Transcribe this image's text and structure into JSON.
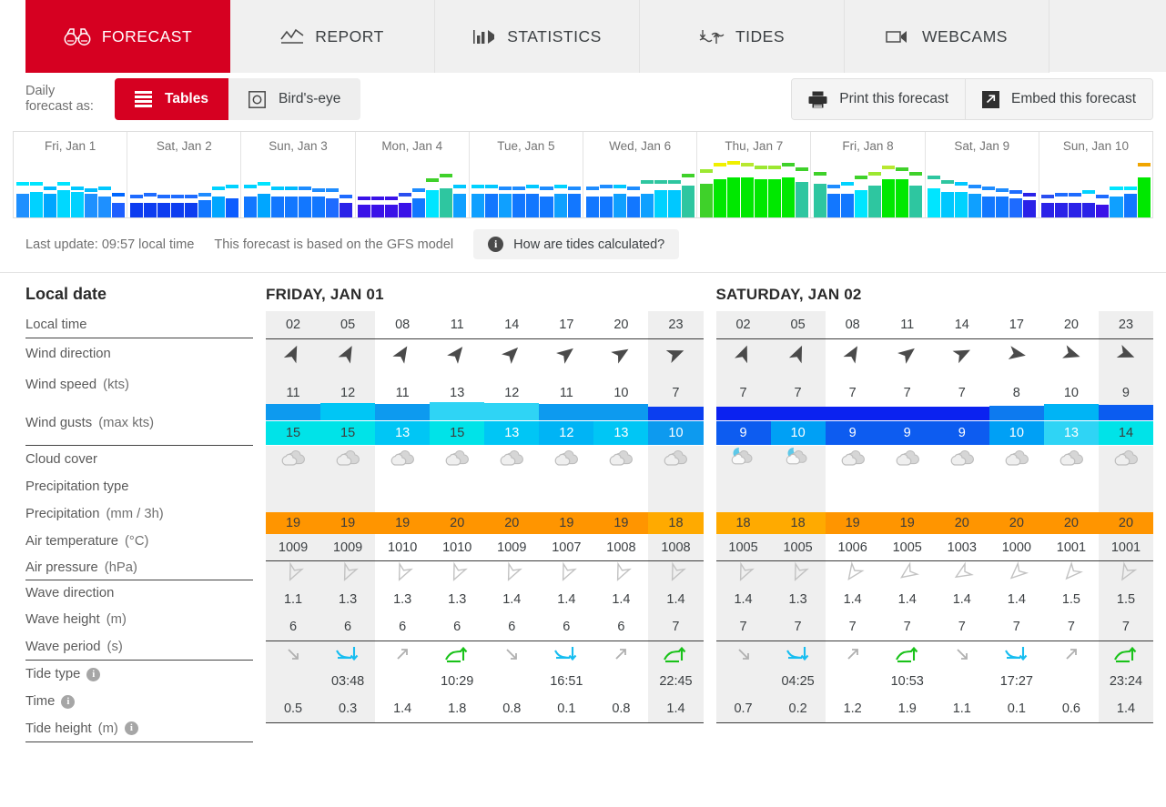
{
  "nav": {
    "tabs": [
      {
        "label": "FORECAST",
        "icon": "binoculars-icon",
        "active": true
      },
      {
        "label": "REPORT",
        "icon": "chart-line-icon",
        "active": false
      },
      {
        "label": "STATISTICS",
        "icon": "bar-chart-icon",
        "active": false
      },
      {
        "label": "TIDES",
        "icon": "tides-icon",
        "active": false
      },
      {
        "label": "WEBCAMS",
        "icon": "video-camera-icon",
        "active": false
      }
    ],
    "active_color": "#d60021"
  },
  "toolbar": {
    "label_line1": "Daily",
    "label_line2": "forecast as:",
    "view_tables": "Tables",
    "view_birdseye": "Bird's-eye",
    "print_label": "Print this forecast",
    "embed_label": "Embed this forecast"
  },
  "status": {
    "last_update": "Last update: 09:57 local time",
    "model": "This forecast is based on the GFS model",
    "tides_help": "How are tides calculated?"
  },
  "overview": {
    "days": [
      {
        "label": "Fri, Jan 1",
        "speed": [
          11,
          12,
          11,
          13,
          12,
          11,
          10,
          7
        ],
        "gust": [
          15,
          15,
          13,
          15,
          13,
          12,
          13,
          10
        ],
        "spd_colors": [
          "#1e90ff",
          "#00d2ff",
          "#00a6ff",
          "#00d8ff",
          "#00d2ff",
          "#1e90ff",
          "#1e90ff",
          "#1e5fff"
        ],
        "gst_colors": [
          "#00e5ff",
          "#00e5ff",
          "#00baff",
          "#00e5ff",
          "#00c8ff",
          "#00baff",
          "#00c8ff",
          "#0066ff"
        ]
      },
      {
        "label": "Sat, Jan 2",
        "speed": [
          7,
          7,
          7,
          7,
          7,
          8,
          10,
          9
        ],
        "gust": [
          9,
          10,
          9,
          9,
          9,
          10,
          13,
          14
        ],
        "spd_colors": [
          "#0d3cf0",
          "#0d3cf0",
          "#0d3cf0",
          "#0d3cf0",
          "#0d3cf0",
          "#1277ff",
          "#00a6ff",
          "#0d5cff"
        ],
        "gst_colors": [
          "#1e6bff",
          "#1e6bff",
          "#1e6bff",
          "#1e6bff",
          "#1e6bff",
          "#1e8cff",
          "#00d2ff",
          "#00d2ff"
        ]
      },
      {
        "label": "Sun, Jan 3",
        "speed": [
          10,
          11,
          10,
          10,
          10,
          10,
          9,
          7
        ],
        "gust": [
          14,
          15,
          13,
          13,
          13,
          12,
          12,
          9
        ],
        "spd_colors": [
          "#1277ff",
          "#00a6ff",
          "#1277ff",
          "#1277ff",
          "#1277ff",
          "#1277ff",
          "#1e6bff",
          "#2a22e8"
        ],
        "gst_colors": [
          "#00d2ff",
          "#00e5ff",
          "#00c8ff",
          "#00baff",
          "#1e8cff",
          "#1e8cff",
          "#1e8cff",
          "#1e6bff"
        ]
      },
      {
        "label": "Mon, Jan 4",
        "speed": [
          6,
          6,
          6,
          7,
          9,
          13,
          14,
          11
        ],
        "gust": [
          8,
          8,
          8,
          10,
          12,
          17,
          19,
          14
        ],
        "spd_colors": [
          "#3a12e8",
          "#3a12e8",
          "#3a12e8",
          "#3a12e8",
          "#1277ff",
          "#00e5ff",
          "#2ec6a0",
          "#0fa0ff"
        ],
        "gst_colors": [
          "#3a12e8",
          "#3a12e8",
          "#3a12e8",
          "#2a4ef0",
          "#1e8cff",
          "#3fd12a",
          "#3fd12a",
          "#00c8ff"
        ]
      },
      {
        "label": "Tue, Jan 5",
        "speed": [
          11,
          11,
          11,
          11,
          11,
          10,
          11,
          11
        ],
        "gust": [
          14,
          14,
          13,
          13,
          14,
          13,
          14,
          13
        ],
        "spd_colors": [
          "#0fa0ff",
          "#1277ff",
          "#0fa0ff",
          "#1277ff",
          "#1277ff",
          "#1277ff",
          "#0fa0ff",
          "#1277ff"
        ],
        "gst_colors": [
          "#00d2ff",
          "#00c8ff",
          "#1e8cff",
          "#1e8cff",
          "#00c8ff",
          "#1e8cff",
          "#00d2ff",
          "#1e8cff"
        ]
      },
      {
        "label": "Wed, Jan 6",
        "speed": [
          10,
          10,
          11,
          10,
          11,
          13,
          13,
          15
        ],
        "gust": [
          13,
          14,
          14,
          13,
          16,
          16,
          16,
          19
        ],
        "spd_colors": [
          "#1277ff",
          "#1277ff",
          "#0fa0ff",
          "#1277ff",
          "#0fa0ff",
          "#00d2ff",
          "#00c8ff",
          "#2ec6a0"
        ],
        "gst_colors": [
          "#1e8cff",
          "#1e8cff",
          "#00c8ff",
          "#1e8cff",
          "#2ec6a0",
          "#2ec6a0",
          "#2ec6a0",
          "#3fd12a"
        ]
      },
      {
        "label": "Thu, Jan 7",
        "speed": [
          16,
          18,
          19,
          19,
          18,
          18,
          19,
          17
        ],
        "gust": [
          21,
          24,
          25,
          24,
          23,
          23,
          24,
          22
        ],
        "spd_colors": [
          "#3fd12a",
          "#00e800",
          "#00e800",
          "#00e800",
          "#00e800",
          "#00e800",
          "#00e800",
          "#2ec6a0"
        ],
        "gst_colors": [
          "#9ce830",
          "#f0f000",
          "#f0f000",
          "#b8e830",
          "#9ce830",
          "#9ce830",
          "#3fd12a",
          "#3fd12a"
        ]
      },
      {
        "label": "Fri, Jan 8",
        "speed": [
          16,
          11,
          11,
          13,
          15,
          18,
          18,
          15
        ],
        "gust": [
          20,
          14,
          15,
          18,
          20,
          23,
          22,
          20
        ],
        "spd_colors": [
          "#2ec6a0",
          "#1277ff",
          "#1277ff",
          "#00e5ff",
          "#2ec6a0",
          "#00e800",
          "#00e800",
          "#2ec6a0"
        ],
        "gst_colors": [
          "#3fd12a",
          "#1e8cff",
          "#00d2ff",
          "#3fd12a",
          "#9ce830",
          "#b8e830",
          "#3fd12a",
          "#3fd12a"
        ]
      },
      {
        "label": "Sat, Jan 9",
        "speed": [
          14,
          12,
          12,
          11,
          10,
          10,
          9,
          8
        ],
        "gust": [
          18,
          16,
          15,
          14,
          13,
          12,
          11,
          10
        ],
        "spd_colors": [
          "#00e5ff",
          "#00c8ff",
          "#00d2ff",
          "#0fa0ff",
          "#1277ff",
          "#1277ff",
          "#1e6bff",
          "#2a22e8"
        ],
        "gst_colors": [
          "#2ec6a0",
          "#2ec6a0",
          "#00c8ff",
          "#1e8cff",
          "#1e8cff",
          "#1e8cff",
          "#1e6bff",
          "#2a22e8"
        ]
      },
      {
        "label": "Sun, Jan 10",
        "speed": [
          7,
          7,
          7,
          7,
          6,
          10,
          11,
          19
        ],
        "gust": [
          9,
          10,
          10,
          11,
          9,
          13,
          13,
          24
        ],
        "spd_colors": [
          "#2a22e8",
          "#2a22e8",
          "#2a22e8",
          "#2a22e8",
          "#3a12e8",
          "#0fa0ff",
          "#1277ff",
          "#00e800"
        ],
        "gst_colors": [
          "#2a4ef0",
          "#1e6bff",
          "#1e6bff",
          "#00d2ff",
          "#1e6bff",
          "#00e5ff",
          "#00e5ff",
          "#f0a500"
        ]
      }
    ]
  },
  "table": {
    "header_label": "Local date",
    "rows": [
      {
        "key": "time",
        "label": "Local time",
        "unit": ""
      },
      {
        "key": "winddir",
        "label": "Wind direction",
        "unit": ""
      },
      {
        "key": "windspeed",
        "label": "Wind speed",
        "unit": "(kts)"
      },
      {
        "key": "windgust",
        "label": "Wind gusts",
        "unit": "(max kts)"
      },
      {
        "key": "cloud",
        "label": "Cloud cover",
        "unit": ""
      },
      {
        "key": "preciptype",
        "label": "Precipitation type",
        "unit": ""
      },
      {
        "key": "precip",
        "label": "Precipitation",
        "unit": "(mm / 3h)"
      },
      {
        "key": "temp",
        "label": "Air temperature",
        "unit": "(°C)"
      },
      {
        "key": "pressure",
        "label": "Air pressure",
        "unit": "(hPa)"
      },
      {
        "key": "wavedir",
        "label": "Wave direction",
        "unit": ""
      },
      {
        "key": "waveheight",
        "label": "Wave height",
        "unit": "(m)"
      },
      {
        "key": "waveperiod",
        "label": "Wave period",
        "unit": "(s)"
      },
      {
        "key": "tidetype",
        "label": "Tide type",
        "unit": "",
        "info": true
      },
      {
        "key": "tidetime",
        "label": "Time",
        "unit": "",
        "info": true
      },
      {
        "key": "tideheight",
        "label": "Tide height",
        "unit": "(m)",
        "info": true
      }
    ],
    "days": [
      {
        "title": "FRIDAY, JAN 01",
        "times": [
          "02",
          "05",
          "08",
          "11",
          "14",
          "17",
          "20",
          "23"
        ],
        "night": [
          true,
          true,
          false,
          false,
          false,
          false,
          false,
          true
        ],
        "wind_dir_deg": [
          25,
          28,
          32,
          38,
          45,
          52,
          58,
          68
        ],
        "wind_speed": [
          11,
          12,
          11,
          13,
          12,
          11,
          10,
          7
        ],
        "wind_speed_colors": [
          "#0d9aef",
          "#00c6f5",
          "#0d9aef",
          "#2fd4f5",
          "#2fd4f5",
          "#0d9aef",
          "#0d9aef",
          "#0b3ef0"
        ],
        "wind_gust": [
          15,
          15,
          13,
          15,
          13,
          12,
          13,
          10
        ],
        "wind_gust_colors": [
          "#00e3e8",
          "#00e3e8",
          "#00c6f5",
          "#00e3e8",
          "#00c6f5",
          "#00b4f5",
          "#00c6f5",
          "#0d9aef"
        ],
        "gust_text_colors": [
          "#3c3c3c",
          "#3c3c3c",
          "#ffffff",
          "#3c3c3c",
          "#ffffff",
          "#ffffff",
          "#ffffff",
          "#ffffff"
        ],
        "cloud": [
          "cloud",
          "cloud",
          "cloud",
          "cloud",
          "cloud",
          "cloud",
          "cloud",
          "cloud"
        ],
        "precip_type": [
          "",
          "",
          "",
          "",
          "",
          "",
          "",
          ""
        ],
        "precip": [
          "",
          "",
          "",
          "",
          "",
          "",
          "",
          ""
        ],
        "temp": [
          19,
          19,
          19,
          20,
          20,
          19,
          19,
          18
        ],
        "temp_colors": [
          "#ff9500",
          "#ff9500",
          "#ff9500",
          "#ff9500",
          "#ff9500",
          "#ff9500",
          "#ff9500",
          "#ffaa00"
        ],
        "pressure": [
          1009,
          1009,
          1010,
          1010,
          1009,
          1007,
          1008,
          1008
        ],
        "wave_dir_deg": [
          205,
          205,
          205,
          205,
          205,
          205,
          205,
          205
        ],
        "wave_height": [
          "1.1",
          "1.3",
          "1.3",
          "1.3",
          "1.4",
          "1.4",
          "1.4",
          "1.4"
        ],
        "wave_period": [
          6,
          6,
          6,
          6,
          6,
          6,
          6,
          7
        ],
        "tide_type": [
          "falling",
          "low",
          "rising",
          "high",
          "falling",
          "low",
          "rising",
          "high"
        ],
        "tide_time": [
          "",
          "03:48",
          "",
          "10:29",
          "",
          "16:51",
          "",
          "22:45"
        ],
        "tide_height": [
          "0.5",
          "0.3",
          "1.4",
          "1.8",
          "0.8",
          "0.1",
          "0.8",
          "1.4"
        ]
      },
      {
        "title": "SATURDAY, JAN 02",
        "times": [
          "02",
          "05",
          "08",
          "11",
          "14",
          "17",
          "20",
          "23"
        ],
        "night": [
          true,
          true,
          false,
          false,
          false,
          false,
          false,
          true
        ],
        "wind_dir_deg": [
          22,
          24,
          30,
          52,
          64,
          100,
          108,
          112
        ],
        "wind_speed": [
          7,
          7,
          7,
          7,
          7,
          8,
          10,
          9
        ],
        "wind_speed_colors": [
          "#0b22f0",
          "#0b22f0",
          "#0b22f0",
          "#0b22f0",
          "#0b22f0",
          "#0d7aef",
          "#00b4f5",
          "#0b5cf0"
        ],
        "wind_gust": [
          9,
          10,
          9,
          9,
          9,
          10,
          13,
          14
        ],
        "wind_gust_colors": [
          "#0d5cf0",
          "#00a0f5",
          "#0d5cf0",
          "#0d5cf0",
          "#0d5cf0",
          "#00a0f5",
          "#2fd4f5",
          "#00e3e8"
        ],
        "gust_text_colors": [
          "#ffffff",
          "#ffffff",
          "#ffffff",
          "#ffffff",
          "#ffffff",
          "#ffffff",
          "#ffffff",
          "#3c3c3c"
        ],
        "cloud": [
          "moon-cloud",
          "moon-cloud",
          "cloud",
          "cloud",
          "cloud",
          "cloud",
          "cloud",
          "cloud"
        ],
        "precip_type": [
          "",
          "",
          "",
          "",
          "",
          "",
          "",
          ""
        ],
        "precip": [
          "",
          "",
          "",
          "",
          "",
          "",
          "",
          ""
        ],
        "temp": [
          18,
          18,
          19,
          19,
          20,
          20,
          20,
          20
        ],
        "temp_colors": [
          "#ffaa00",
          "#ffaa00",
          "#ff9500",
          "#ff9500",
          "#ff9500",
          "#ff9500",
          "#ff9500",
          "#ff9500"
        ],
        "pressure": [
          1005,
          1005,
          1006,
          1005,
          1003,
          1000,
          1001,
          1001
        ],
        "wave_dir_deg": [
          205,
          205,
          215,
          235,
          238,
          228,
          222,
          210
        ],
        "wave_height": [
          "1.4",
          "1.3",
          "1.4",
          "1.4",
          "1.4",
          "1.4",
          "1.5",
          "1.5"
        ],
        "wave_period": [
          7,
          7,
          7,
          7,
          7,
          7,
          7,
          7
        ],
        "tide_type": [
          "falling",
          "low",
          "rising",
          "high",
          "falling",
          "low",
          "rising",
          "high"
        ],
        "tide_time": [
          "",
          "04:25",
          "",
          "10:53",
          "",
          "17:27",
          "",
          "23:24"
        ],
        "tide_height": [
          "0.7",
          "0.2",
          "1.2",
          "1.9",
          "1.1",
          "0.1",
          "0.6",
          "1.4"
        ]
      }
    ]
  }
}
